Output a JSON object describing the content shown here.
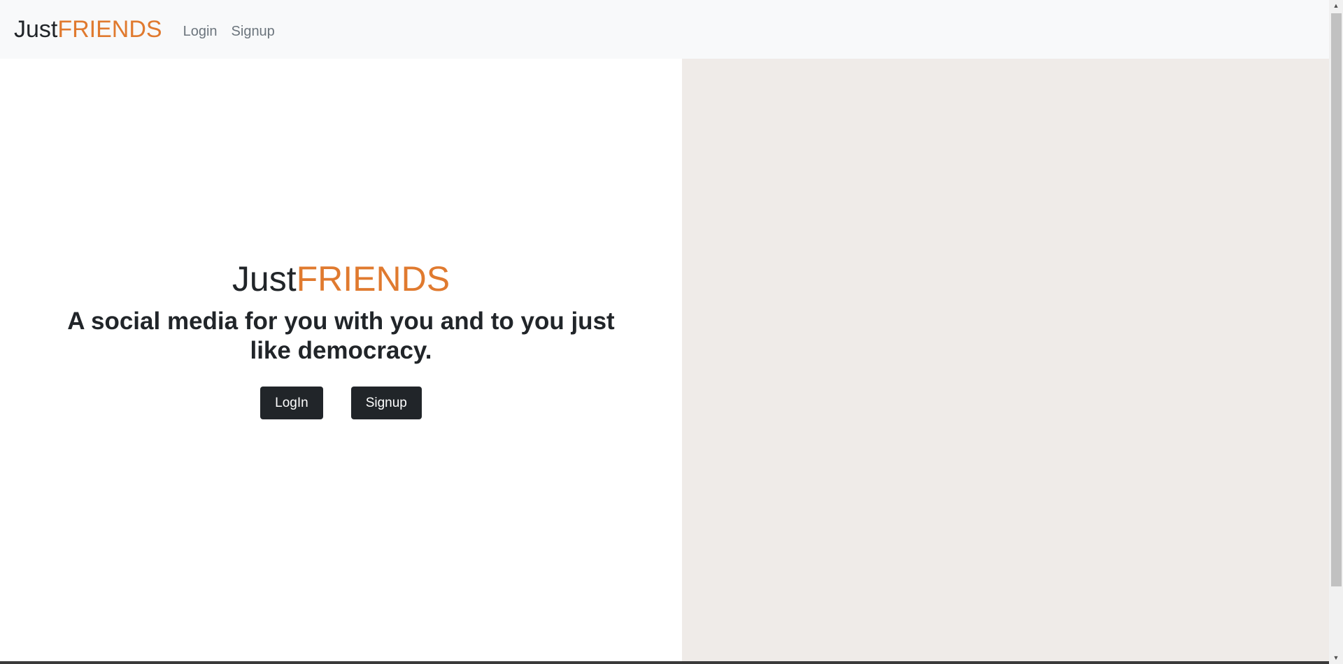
{
  "navbar": {
    "brand_prefix": "Just",
    "brand_suffix": "FRIENDS",
    "links": [
      "Login",
      "Signup"
    ]
  },
  "hero": {
    "title_prefix": "Just",
    "title_suffix": "FRIENDS",
    "tagline": "A social media for you with you and to you just like democracy.",
    "login_label": "LogIn",
    "signup_label": "Signup"
  },
  "colors": {
    "accent": "#e07a2f",
    "dark": "#212529",
    "navbar_bg": "#f8f9fa",
    "right_pane_bg": "#efebe8"
  },
  "icons": {
    "scroll_up": "chevron-up-icon",
    "scroll_down": "chevron-down-icon"
  }
}
